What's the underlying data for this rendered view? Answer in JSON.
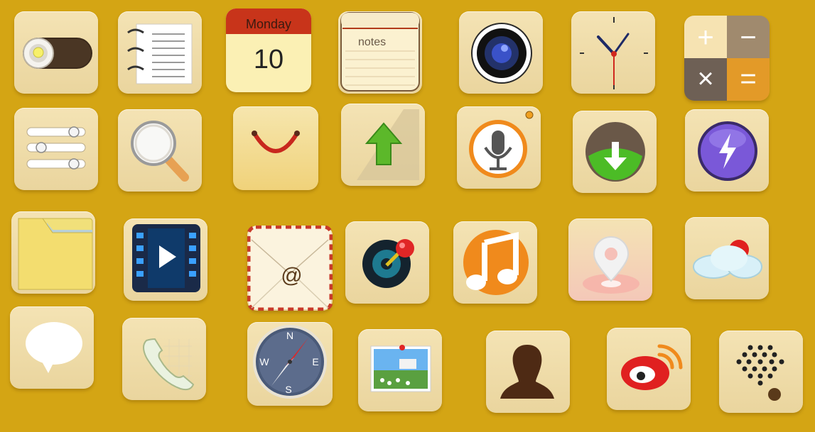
{
  "apps": [
    {
      "id": "toggle",
      "icon": "toggle-switch-icon"
    },
    {
      "id": "contacts-book",
      "icon": "notebook-icon"
    },
    {
      "id": "calendar",
      "icon": "calendar-icon",
      "weekday": "Monday",
      "day": "10",
      "colors": {
        "header": "#c8341a"
      }
    },
    {
      "id": "notes",
      "icon": "notepad-icon",
      "label": "notes"
    },
    {
      "id": "camera",
      "icon": "camera-lens-icon"
    },
    {
      "id": "clock",
      "icon": "clock-icon"
    },
    {
      "id": "calculator",
      "icon": "calculator-icon",
      "keys": [
        "+",
        "−",
        "×",
        "="
      ]
    },
    {
      "id": "settings",
      "icon": "sliders-icon"
    },
    {
      "id": "search",
      "icon": "magnifier-icon"
    },
    {
      "id": "store",
      "icon": "shopping-bag-icon"
    },
    {
      "id": "upload",
      "icon": "upload-arrow-icon"
    },
    {
      "id": "voice",
      "icon": "microphone-icon"
    },
    {
      "id": "download",
      "icon": "download-arrow-icon"
    },
    {
      "id": "power",
      "icon": "lightning-orb-icon"
    },
    {
      "id": "files",
      "icon": "folder-icon"
    },
    {
      "id": "video",
      "icon": "film-play-icon"
    },
    {
      "id": "mail",
      "icon": "envelope-icon",
      "symbol": "@"
    },
    {
      "id": "record",
      "icon": "vinyl-pin-icon"
    },
    {
      "id": "music",
      "icon": "music-note-icon"
    },
    {
      "id": "location",
      "icon": "map-pin-icon"
    },
    {
      "id": "weather",
      "icon": "cloud-sun-icon"
    },
    {
      "id": "messages",
      "icon": "speech-bubble-icon"
    },
    {
      "id": "phone",
      "icon": "phone-handset-icon"
    },
    {
      "id": "compass",
      "icon": "compass-icon",
      "directions": {
        "n": "N",
        "e": "E",
        "s": "S",
        "w": "W"
      }
    },
    {
      "id": "photos",
      "icon": "photo-frame-icon"
    },
    {
      "id": "contacts",
      "icon": "person-silhouette-icon"
    },
    {
      "id": "weibo",
      "icon": "weibo-icon"
    },
    {
      "id": "speaker",
      "icon": "speaker-grille-icon"
    }
  ],
  "colors": {
    "background": "#d4a514",
    "tile": "#f1dfaa",
    "orange": "#f08a1c",
    "green": "#5cb82a"
  }
}
